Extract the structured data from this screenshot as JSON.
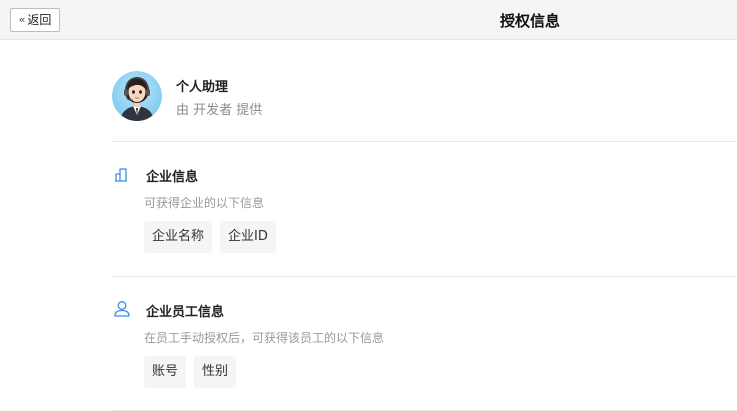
{
  "header": {
    "back_label": "返回",
    "title": "授权信息"
  },
  "app": {
    "name": "个人助理",
    "provider": "由 开发者 提供"
  },
  "sections": [
    {
      "icon": "building-icon",
      "title": "企业信息",
      "desc": "可获得企业的以下信息",
      "tags": [
        "企业名称",
        "企业ID"
      ]
    },
    {
      "icon": "user-icon",
      "title": "企业员工信息",
      "desc": "在员工手动授权后，可获得该员工的以下信息",
      "tags": [
        "账号",
        "性别"
      ]
    }
  ],
  "colors": {
    "accent": "#3b8ee8",
    "header_bg": "#f5f5f5",
    "tag_bg": "#f5f5f5"
  }
}
